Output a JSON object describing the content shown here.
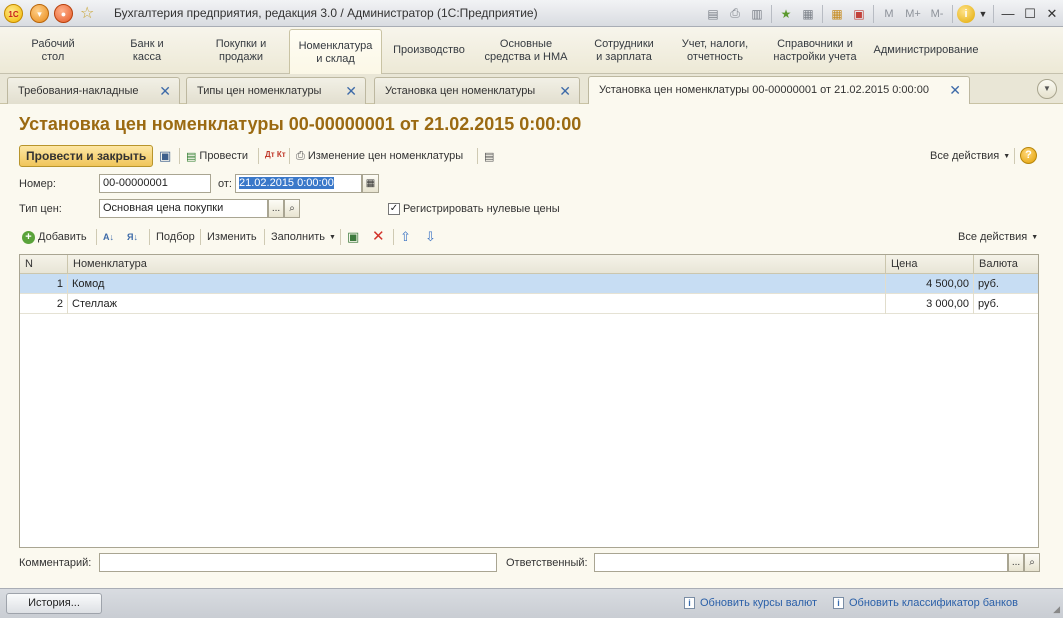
{
  "window": {
    "title": "Бухгалтерия предприятия, редакция 3.0 / Администратор  (1С:Предприятие)",
    "logo_text": "1С",
    "toolbar_m_labels": [
      "M",
      "M+",
      "M-"
    ],
    "info_label": "i"
  },
  "sections": [
    {
      "label": "Рабочий\nстол"
    },
    {
      "label": "Банк и\nкасса"
    },
    {
      "label": "Покупки и\nпродажи"
    },
    {
      "label": "Номенклатура\nи склад",
      "active": true
    },
    {
      "label": "Производство"
    },
    {
      "label": "Основные\nсредства и НМА"
    },
    {
      "label": "Сотрудники\nи зарплата"
    },
    {
      "label": "Учет, налоги,\nотчетность"
    },
    {
      "label": "Справочники и\nнастройки учета"
    },
    {
      "label": "Администрирование"
    }
  ],
  "tabs": [
    {
      "label": "Требования-накладные"
    },
    {
      "label": "Типы цен номенклатуры"
    },
    {
      "label": "Установка цен номенклатуры"
    },
    {
      "label": "Установка цен номенклатуры 00-00000001 от 21.02.2015 0:00:00",
      "active": true
    }
  ],
  "form": {
    "title": "Установка цен номенклатуры 00-00000001 от 21.02.2015 0:00:00",
    "toolbar": {
      "post_close": "Провести и закрыть",
      "post": "Провести",
      "dt_kt": "Дт Кт",
      "price_change": "Изменение цен номенклатуры",
      "all_actions": "Все действия",
      "help": "?"
    },
    "number_label": "Номер:",
    "number_value": "00-00000001",
    "date_label": "от:",
    "date_value": "21.02.2015  0:00:00",
    "price_type_label": "Тип цен:",
    "price_type_value": "Основная цена покупки",
    "register_zero_label": "Регистрировать нулевые цены",
    "register_zero_checked": true,
    "table_toolbar": {
      "add": "Добавить",
      "select": "Подбор",
      "change": "Изменить",
      "fill": "Заполнить",
      "all_actions": "Все действия"
    },
    "table": {
      "columns": [
        "N",
        "Номенклатура",
        "Цена",
        "Валюта"
      ],
      "rows": [
        {
          "n": "1",
          "item": "Комод",
          "price": "4 500,00",
          "currency": "руб."
        },
        {
          "n": "2",
          "item": "Стеллаж",
          "price": "3 000,00",
          "currency": "руб."
        }
      ],
      "selected_row": 0
    },
    "comment_label": "Комментарий:",
    "comment_value": "",
    "responsible_label": "Ответственный:",
    "responsible_value": "",
    "select_btn": "...",
    "search_btn": "🔍"
  },
  "statusbar": {
    "history": "История...",
    "link_rates": "Обновить курсы валют",
    "link_banks": "Обновить классификатор банков"
  },
  "colors": {
    "accent_title": "#9b6a12",
    "primary_button": "#f0c55a",
    "selected_row": "#c7ddf3",
    "link": "#2a5fa8"
  }
}
